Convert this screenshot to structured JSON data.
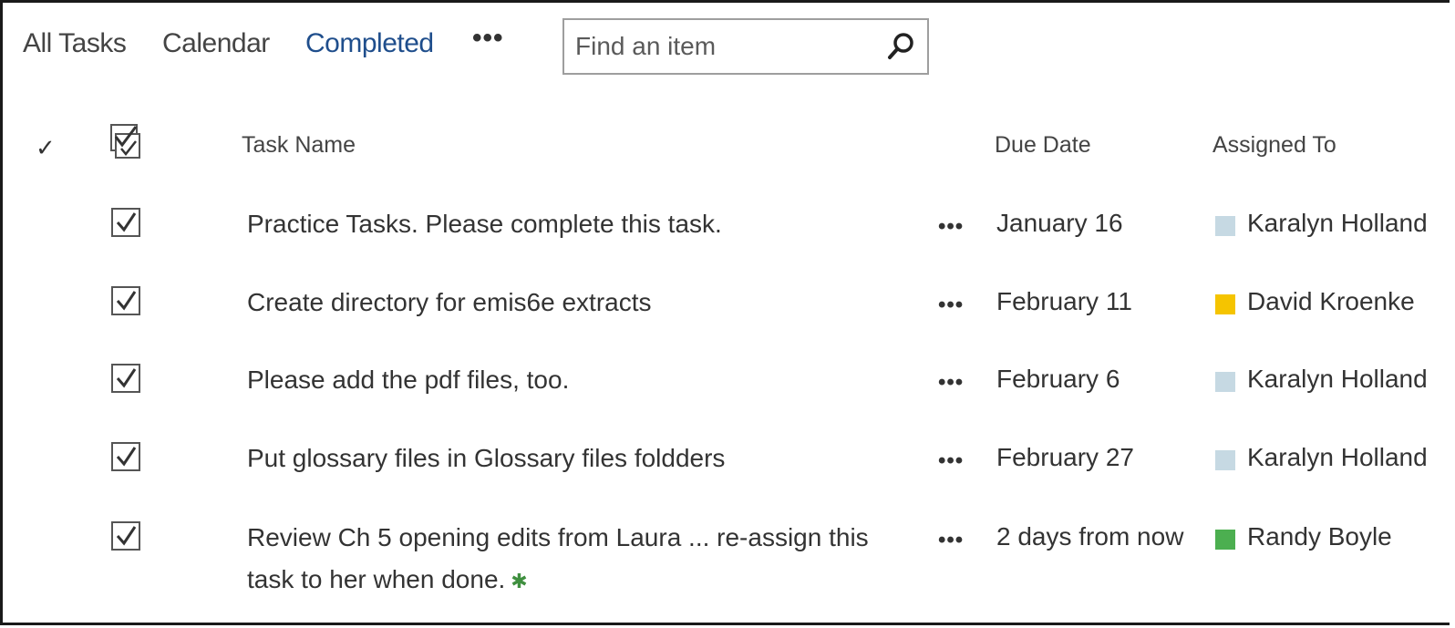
{
  "views": {
    "tabs": [
      {
        "label": "All Tasks"
      },
      {
        "label": "Calendar"
      },
      {
        "label": "Completed",
        "selected": true
      }
    ],
    "more_label": "•••"
  },
  "search": {
    "placeholder": "Find an item",
    "icon": "magnifier-icon"
  },
  "list": {
    "header_check": "✓",
    "columns": {
      "name": "Task Name",
      "due": "Due Date",
      "assigned": "Assigned To"
    },
    "more_label": "•••",
    "rows": [
      {
        "title": "Practice Tasks. Please complete this task.",
        "due": "January 16",
        "assigned": "Karalyn Holland",
        "presence_color": "#c6d9e3",
        "completed": true
      },
      {
        "title": "Create directory for emis6e extracts",
        "due": "February 11",
        "assigned": "David Kroenke",
        "presence_color": "#f5c400",
        "completed": true
      },
      {
        "title": "Please add the pdf files, too.",
        "due": "February 6",
        "assigned": "Karalyn Holland",
        "presence_color": "#c6d9e3",
        "completed": true
      },
      {
        "title": "Put glossary files in Glossary files foldders",
        "due": "February 27",
        "assigned": "Karalyn Holland",
        "presence_color": "#c6d9e3",
        "completed": true
      },
      {
        "title": "Review Ch 5 opening edits from Laura ... re-assign this task to her when done.",
        "due": "2 days from now",
        "assigned": "Randy Boyle",
        "presence_color": "#4caf50",
        "completed": true,
        "new_badge": "✱"
      }
    ]
  },
  "colors": {
    "selected_view": "#1f4e8c",
    "text": "#333333",
    "new_badge": "#3f8f3f"
  }
}
